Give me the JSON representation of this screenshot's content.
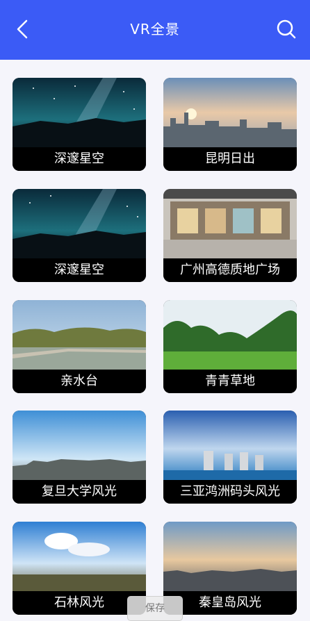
{
  "header": {
    "title": "VR全景",
    "background": "#3b5bf6",
    "back_icon": "chevron-left-icon",
    "search_icon": "search-icon"
  },
  "cards": [
    {
      "label": "深邃星空"
    },
    {
      "label": "昆明日出"
    },
    {
      "label": "深邃星空"
    },
    {
      "label": "广州高德质地广场"
    },
    {
      "label": "亲水台"
    },
    {
      "label": "青青草地"
    },
    {
      "label": "复旦大学风光"
    },
    {
      "label": "三亚鸿洲码头风光"
    },
    {
      "label": "石林风光"
    },
    {
      "label": "秦皇岛风光"
    }
  ],
  "save_button": {
    "label": "保存"
  }
}
